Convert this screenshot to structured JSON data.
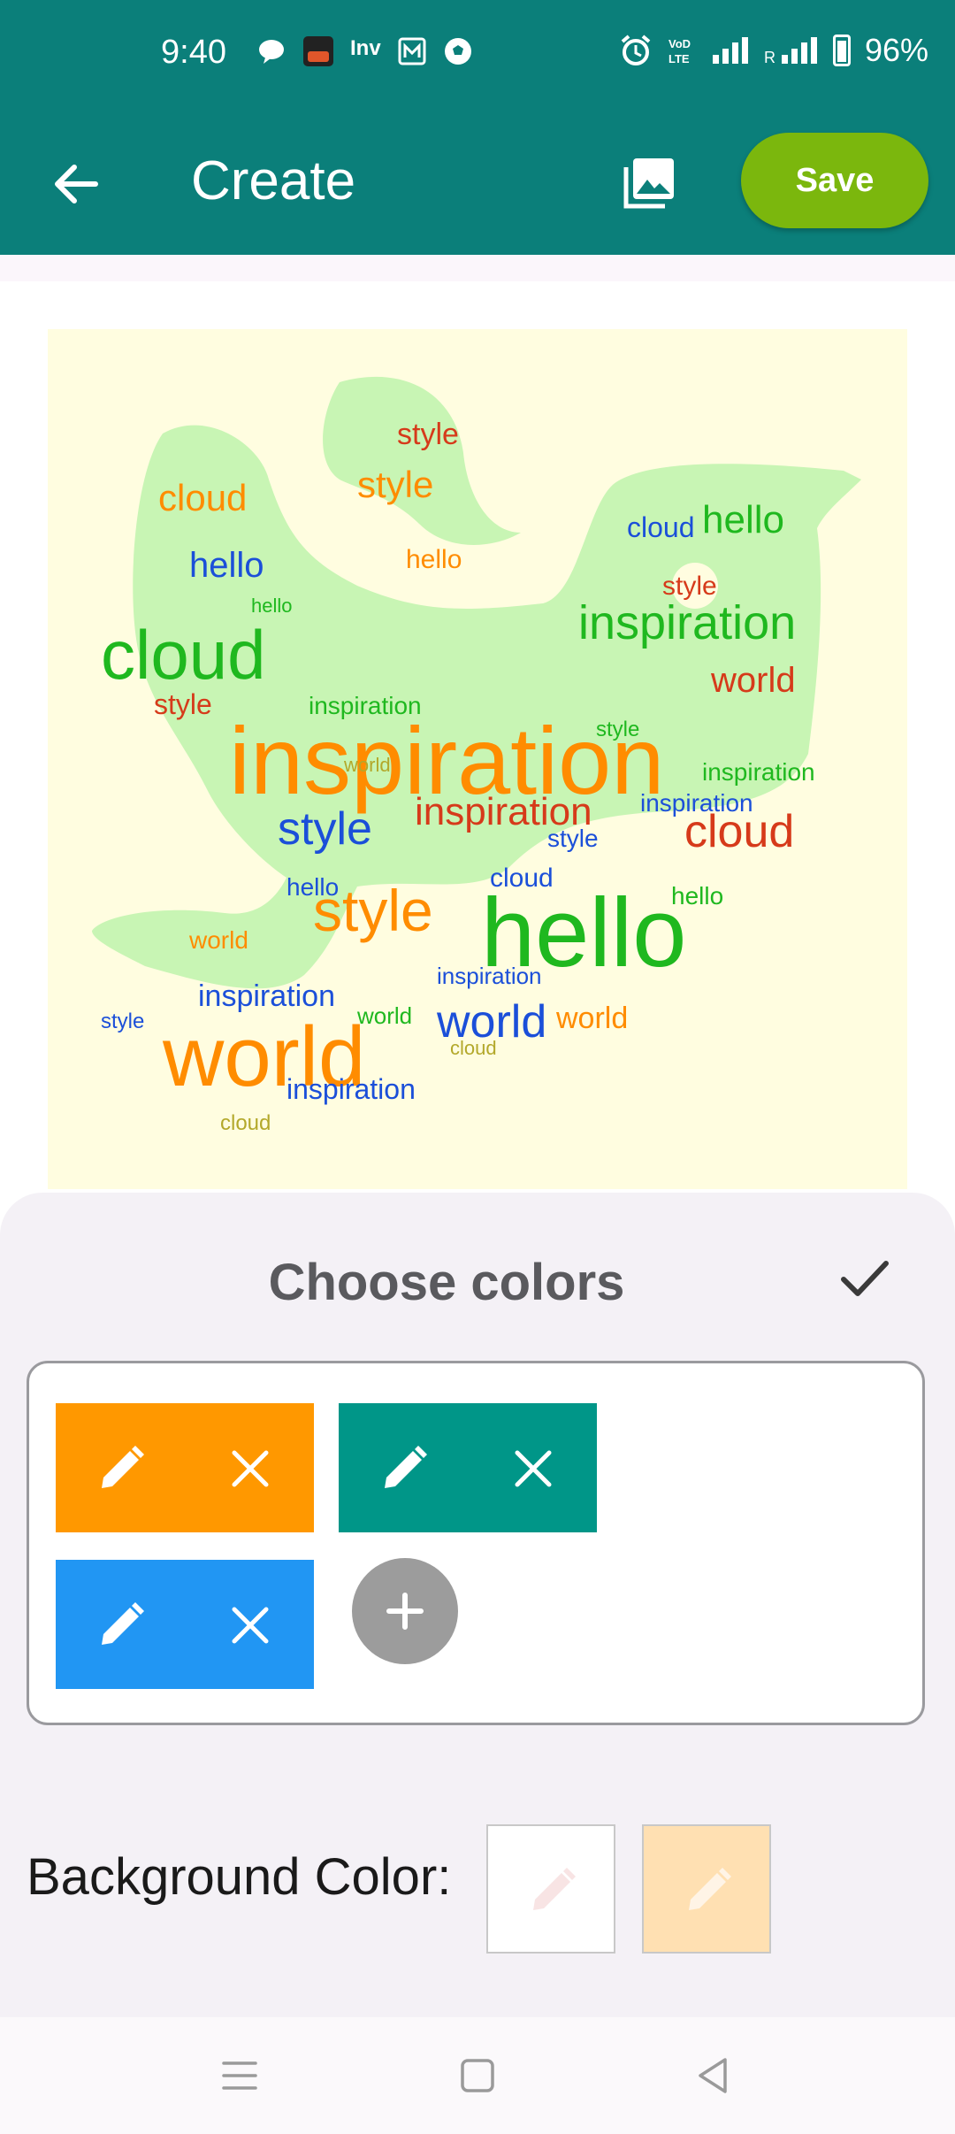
{
  "status_bar": {
    "time": "9:40",
    "battery": "96%",
    "net_label": "Inv",
    "icons": [
      "message-icon",
      "sonyliv-icon",
      "inv-icon",
      "m-icon",
      "football-icon",
      "alarm-icon",
      "volte-icon",
      "signal-icon",
      "signal-r-icon",
      "battery-icon"
    ]
  },
  "app_bar": {
    "title": "Create",
    "save_label": "Save",
    "color": "#0b7f7a",
    "save_color": "#7bb70d"
  },
  "word_cloud": {
    "background": "#fffde0",
    "shape_color": "#c8f5b4",
    "words": [
      "inspiration",
      "hello",
      "world",
      "style",
      "cloud"
    ],
    "colors": [
      "#ff8c00",
      "#1fb81f",
      "#1b4fd9",
      "#d63a1a",
      "#b3a82a"
    ]
  },
  "color_sheet": {
    "title": "Choose colors",
    "colors": [
      {
        "hex": "#ff9800",
        "edit_icon": "pencil-icon",
        "remove_icon": "close-icon"
      },
      {
        "hex": "#009688",
        "edit_icon": "pencil-icon",
        "remove_icon": "close-icon"
      },
      {
        "hex": "#2196f3",
        "edit_icon": "pencil-icon",
        "remove_icon": "close-icon"
      }
    ],
    "add_icon": "plus-icon",
    "background_label": "Background Color:",
    "background_colors": [
      "#ffffff",
      "#ffe0b2"
    ]
  },
  "nav_bar": {
    "icons": [
      "menu-icon",
      "home-icon",
      "back-icon"
    ]
  }
}
